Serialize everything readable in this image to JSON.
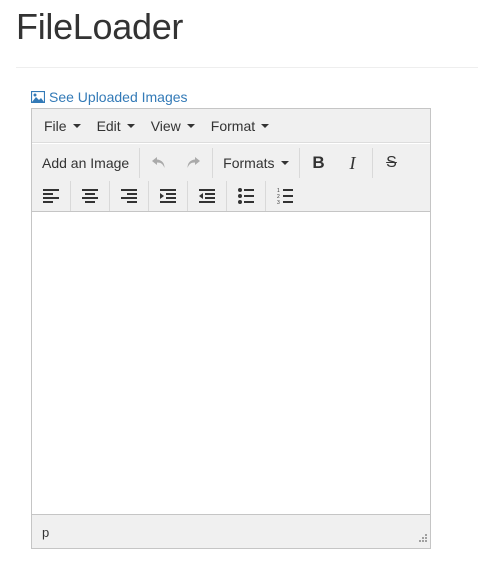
{
  "page": {
    "title": "FileLoader"
  },
  "link": {
    "label": "See Uploaded Images",
    "color": "#337ab7"
  },
  "menubar": {
    "items": [
      {
        "label": "File"
      },
      {
        "label": "Edit"
      },
      {
        "label": "View"
      },
      {
        "label": "Format"
      }
    ]
  },
  "toolbar": {
    "add_image_label": "Add an Image",
    "formats_label": "Formats",
    "bold_label": "B",
    "italic_label": "I",
    "strike_label": "S",
    "icons": {
      "undo": "undo-icon",
      "redo": "redo-icon",
      "align_left": "align-left-icon",
      "align_center": "align-center-icon",
      "align_right": "align-right-icon",
      "indent": "indent-icon",
      "outdent": "outdent-icon",
      "bullet_list": "bullet-list-icon",
      "numbered_list": "numbered-list-icon"
    }
  },
  "statusbar": {
    "path": "p"
  }
}
